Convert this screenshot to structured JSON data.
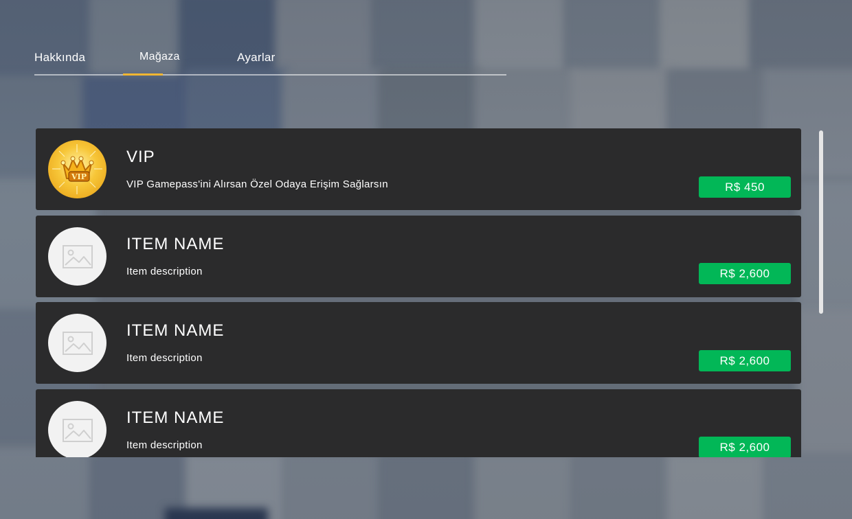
{
  "tabs": [
    {
      "label": "Hakkında"
    },
    {
      "label": "Mağaza"
    },
    {
      "label": "Ayarlar"
    }
  ],
  "active_tab": "Mağaza",
  "items": [
    {
      "title": "VIP",
      "description": "VIP Gamepass'ini Alırsan Özel Odaya Erişim Sağlarsın",
      "price": "R$ 450",
      "image": "vip-crown-icon"
    },
    {
      "title": "ITEM NAME",
      "description": "Item description",
      "price": "R$ 2,600",
      "image": "image-placeholder-icon"
    },
    {
      "title": "ITEM NAME",
      "description": "Item description",
      "price": "R$ 2,600",
      "image": "image-placeholder-icon"
    },
    {
      "title": "ITEM NAME",
      "description": "Item description",
      "price": "R$ 2,600",
      "image": "image-placeholder-icon"
    }
  ],
  "colors": {
    "accent_tab": "#f2b632",
    "buy_button": "#02b757",
    "card_bg": "#2b2b2c"
  }
}
